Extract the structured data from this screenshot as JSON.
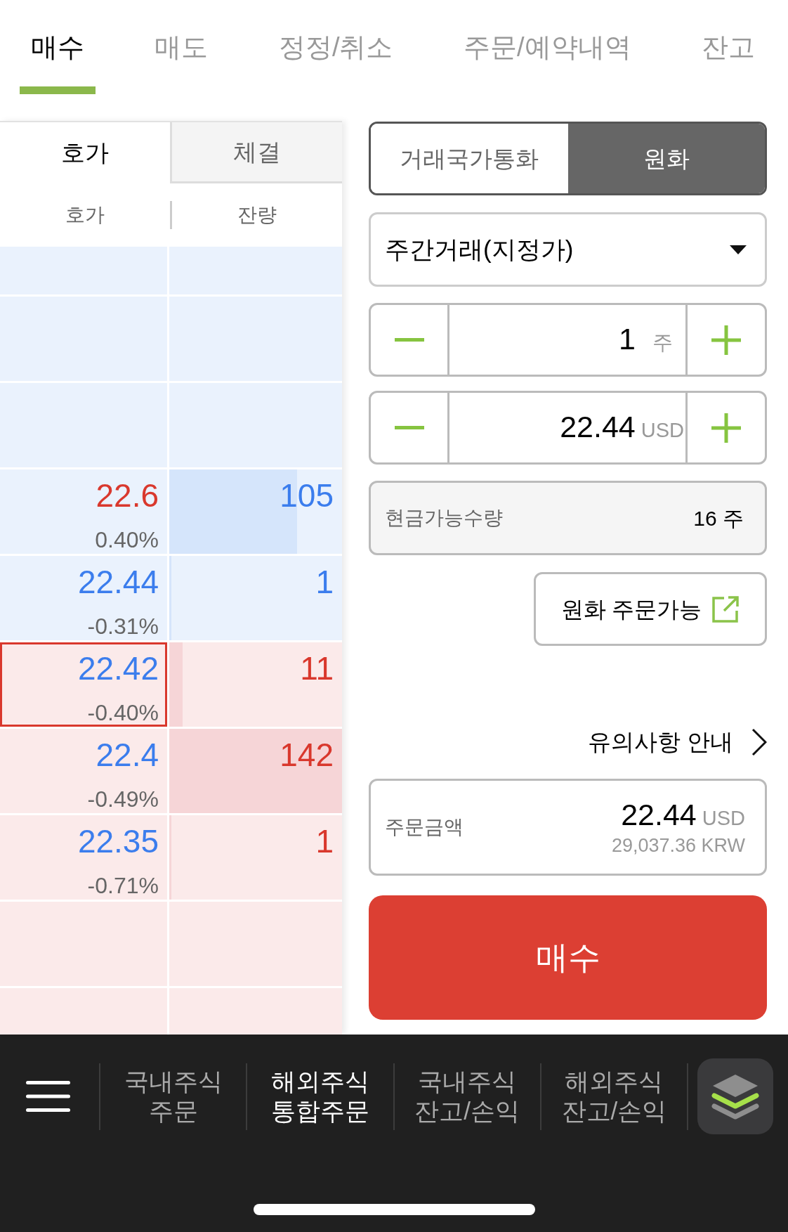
{
  "order_tabs": [
    {
      "label": "매수",
      "selected": true
    },
    {
      "label": "매도",
      "selected": false
    },
    {
      "label": "정정/취소",
      "selected": false
    },
    {
      "label": "주문/예약내역",
      "selected": false
    },
    {
      "label": "잔고",
      "selected": false
    }
  ],
  "order_book": {
    "tabs": [
      {
        "label": "호가",
        "selected": true
      },
      {
        "label": "체결",
        "selected": false
      }
    ],
    "columns": [
      "호가",
      "잔량"
    ],
    "rows": [
      {
        "kind": "ask",
        "selected": false
      },
      {
        "kind": "ask",
        "selected": false
      },
      {
        "kind": "ask",
        "selected": false
      },
      {
        "kind": "ask",
        "price": "22.6",
        "color": "#d9382d",
        "change": "0.40%",
        "quantity": "105",
        "selected": false
      },
      {
        "kind": "ask",
        "price": "22.44",
        "color": "#3b7ded",
        "change": "-0.31%",
        "quantity": "1",
        "selected": false
      },
      {
        "kind": "bid",
        "price": "22.42",
        "color": "#3b7ded",
        "change": "-0.40%",
        "quantity": "11",
        "selected": true
      },
      {
        "kind": "bid",
        "price": "22.4",
        "color": "#3b7ded",
        "change": "-0.49%",
        "quantity": "142",
        "selected": false
      },
      {
        "kind": "bid",
        "price": "22.35",
        "color": "#3b7ded",
        "change": "-0.71%",
        "quantity": "1",
        "selected": false
      },
      {
        "kind": "bid",
        "selected": false
      },
      {
        "kind": "bid",
        "selected": false
      }
    ]
  },
  "currency_toggle": {
    "options": [
      {
        "label": "거래국가통화",
        "selected": false
      },
      {
        "label": "원화",
        "selected": true
      }
    ]
  },
  "order_type": {
    "value": "주간거래(지정가)"
  },
  "quantity": {
    "value": "1",
    "unit": "주"
  },
  "price": {
    "value": "22.44",
    "unit": "USD"
  },
  "available_quantity": {
    "label": "현금가능수량",
    "value": "16 주"
  },
  "krw_orderable_button": {
    "label": "원화 주문가능"
  },
  "notice_link": {
    "label": "유의사항 안내"
  },
  "order_amount": {
    "label": "주문금액",
    "value": "22.44",
    "unit": "USD",
    "converted": "29,037.36 KRW"
  },
  "submit_button": {
    "label": "매수"
  },
  "bottom_nav": {
    "items": [
      {
        "label": "국내주식 주문",
        "selected": false
      },
      {
        "label": "해외주식 통합주문",
        "selected": true
      },
      {
        "label": "국내주식 잔고/손익",
        "selected": false
      },
      {
        "label": "해외주식 잔고/손익",
        "selected": false
      }
    ]
  }
}
